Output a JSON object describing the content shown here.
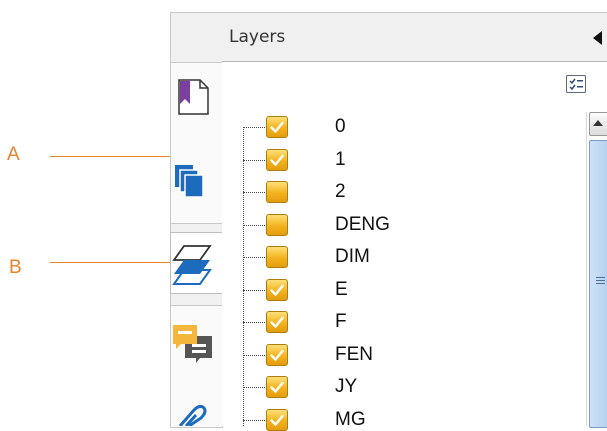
{
  "panel": {
    "title": "Layers"
  },
  "callouts": [
    {
      "label": "A"
    },
    {
      "label": "B"
    }
  ],
  "layers": [
    {
      "name": "0",
      "checked": true
    },
    {
      "name": "1",
      "checked": true
    },
    {
      "name": "2",
      "checked": false
    },
    {
      "name": "DENG",
      "checked": false
    },
    {
      "name": "DIM",
      "checked": false
    },
    {
      "name": "E",
      "checked": true
    },
    {
      "name": "F",
      "checked": true
    },
    {
      "name": "FEN",
      "checked": true
    },
    {
      "name": "JY",
      "checked": true
    },
    {
      "name": "MG",
      "checked": true
    }
  ],
  "colors": {
    "callout": "#e8832a",
    "checkbox": "#f3b31d",
    "bookmark_purple": "#7b3fa0",
    "pages_blue": "#1c6bbd",
    "comment_yellow": "#f5b63c",
    "comment_gray": "#555555",
    "scroll_thumb": "#b4d0ef"
  },
  "icons": {
    "bookmarks_tab": "bookmark-icon",
    "pages_tab": "pages-icon",
    "layers_tab": "layers-icon",
    "comments_tab": "comment-icon",
    "attachments_tab": "paperclip-icon",
    "options": "options-menu-icon",
    "collapse": "collapse-arrow-icon"
  }
}
